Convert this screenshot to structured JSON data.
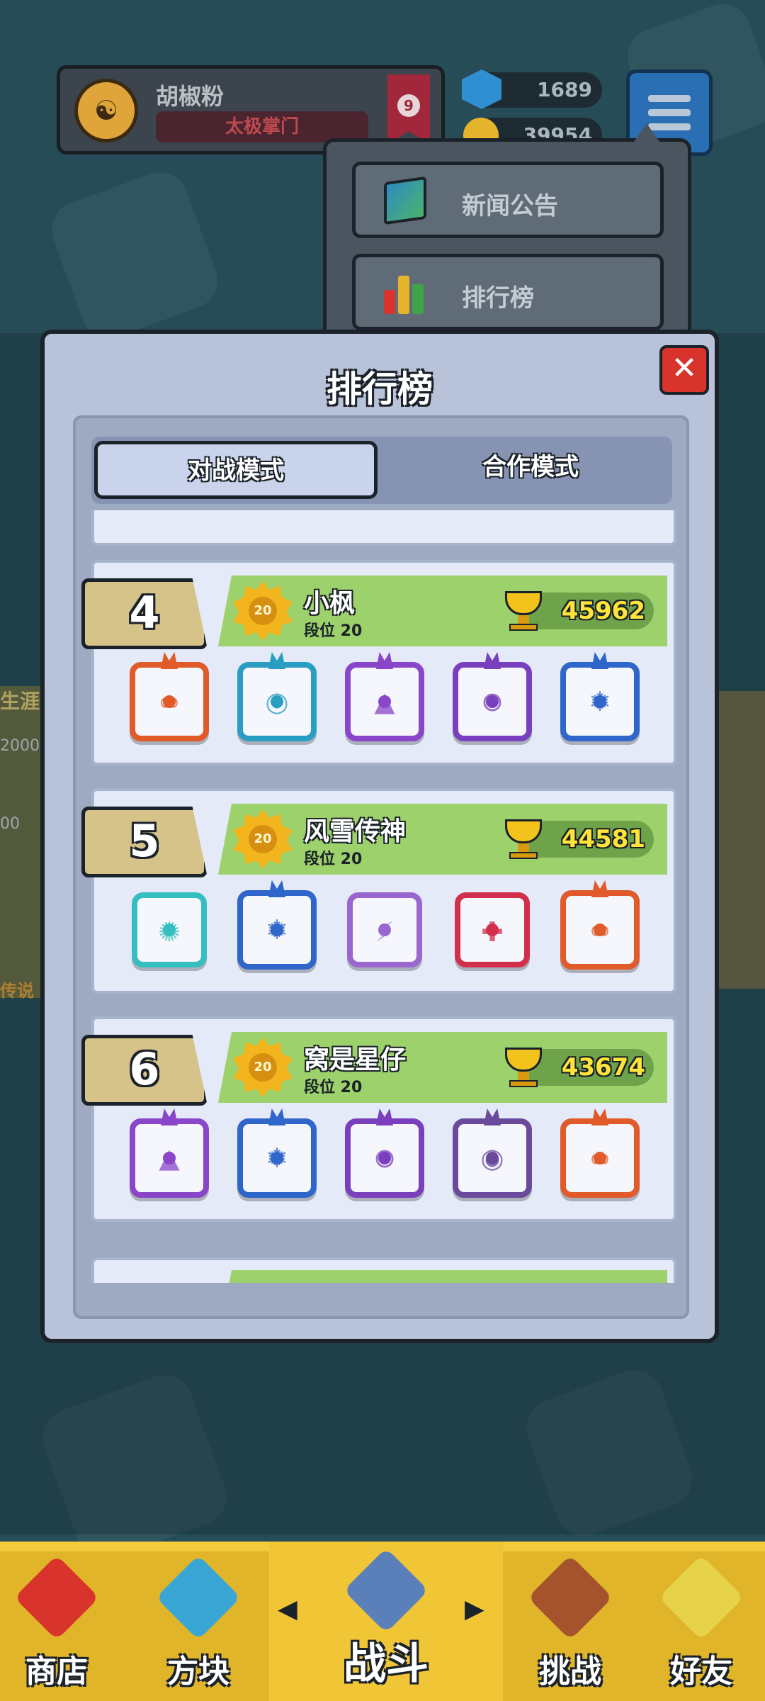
{
  "profile": {
    "name": "胡椒粉",
    "title": "太极掌门",
    "level": "9",
    "gems": "1689",
    "coins": "39954"
  },
  "dropdown": {
    "items": [
      {
        "label": "新闻公告",
        "icon": "news-monitor-icon"
      },
      {
        "label": "排行榜",
        "icon": "leaderboard-bars-icon"
      }
    ]
  },
  "side_fragments": {
    "left_top": "生涯",
    "left_value_1": "2000",
    "left_value_2": "00",
    "left_bottom": "传说"
  },
  "leaderboard": {
    "title": "排行榜",
    "close_icon": "close-x-icon",
    "tabs": {
      "active": "对战模式",
      "inactive": "合作模式"
    },
    "entries": [
      {
        "rank": "4",
        "name": "小枫",
        "tier_label": "段位 20",
        "medal": "20",
        "score": "45962",
        "dice": [
          {
            "color": "#e05a2a",
            "symbol": "∞",
            "kind": "dragon"
          },
          {
            "color": "#2a9ec2",
            "symbol": "◎",
            "kind": "dragon"
          },
          {
            "color": "#8a45c9",
            "symbol": "▲",
            "kind": "dragon"
          },
          {
            "color": "#7a3fbd",
            "symbol": "⊛",
            "kind": "dragon"
          },
          {
            "color": "#2f66c9",
            "symbol": "❄",
            "kind": "dragon"
          }
        ]
      },
      {
        "rank": "5",
        "name": "风雪传神",
        "tier_label": "段位 20",
        "medal": "20",
        "score": "44581",
        "dice": [
          {
            "color": "#35bfc0",
            "symbol": "✺",
            "kind": "plain"
          },
          {
            "color": "#2f66c9",
            "symbol": "❄",
            "kind": "dragon"
          },
          {
            "color": "#9a66cf",
            "symbol": "⚡",
            "kind": "plain"
          },
          {
            "color": "#d22f4c",
            "symbol": "✚",
            "kind": "plain"
          },
          {
            "color": "#e05a2a",
            "symbol": "∞",
            "kind": "dragon"
          }
        ]
      },
      {
        "rank": "6",
        "name": "窝是星仔",
        "tier_label": "段位 20",
        "medal": "20",
        "score": "43674",
        "dice": [
          {
            "color": "#8a45c9",
            "symbol": "▲",
            "kind": "dragon"
          },
          {
            "color": "#2f66c9",
            "symbol": "❄",
            "kind": "dragon"
          },
          {
            "color": "#7a3fbd",
            "symbol": "⊛",
            "kind": "dragon"
          },
          {
            "color": "#6a4a9a",
            "symbol": "◉",
            "kind": "dragon"
          },
          {
            "color": "#e05a2a",
            "symbol": "∞",
            "kind": "dragon"
          }
        ]
      }
    ]
  },
  "bottom_nav": {
    "items": [
      {
        "label": "商店",
        "icon": "shop-icon"
      },
      {
        "label": "方块",
        "icon": "dice-box-icon"
      },
      {
        "label": "战斗",
        "icon": "battle-shield-icon"
      },
      {
        "label": "挑战",
        "icon": "challenge-board-icon"
      },
      {
        "label": "好友",
        "icon": "friends-icon"
      }
    ]
  },
  "colors": {
    "background": "#264c57",
    "modal": "#b8c3d9",
    "rank_bar": "#9dd16b",
    "score_text": "#ffe43a",
    "close_button": "#d9342b",
    "nav": "#e1b52a"
  }
}
